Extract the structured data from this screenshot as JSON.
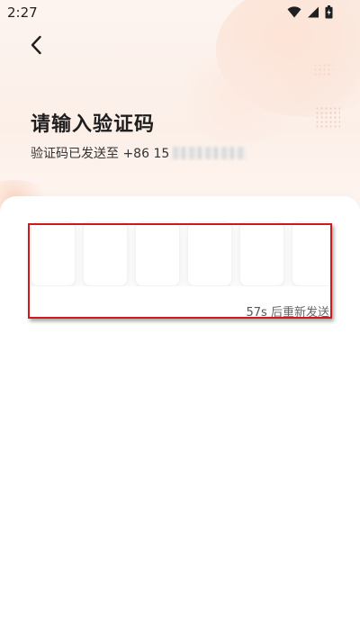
{
  "status_bar": {
    "time": "2:27",
    "icons": [
      "wifi-icon",
      "signal-icon",
      "battery-icon"
    ]
  },
  "header": {
    "back_icon": "chevron-left-icon"
  },
  "page": {
    "title": "请输入验证码",
    "subtitle_prefix": "验证码已发送至 +86 15",
    "phone_masked": true
  },
  "code_input": {
    "box_count": 6,
    "values": [
      "",
      "",
      "",
      "",
      "",
      ""
    ]
  },
  "resend": {
    "seconds": "57s",
    "label": "后重新发送"
  },
  "colors": {
    "highlight": "#d0191f",
    "background_tint": "#fcefe8"
  }
}
